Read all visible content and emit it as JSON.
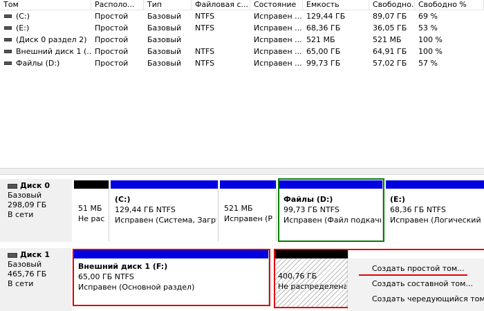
{
  "columns": [
    "Том",
    "Располо...",
    "Тип",
    "Файловая с...",
    "Состояние",
    "Емкость",
    "Свободно...",
    "Свободно %"
  ],
  "volumes": [
    {
      "name": "(C:)",
      "layout": "Простой",
      "type": "Базовый",
      "fs": "NTFS",
      "status": "Исправен ...",
      "capacity": "129,44 ГБ",
      "free": "89,07 ГБ",
      "free_pct": "69 %"
    },
    {
      "name": "(E:)",
      "layout": "Простой",
      "type": "Базовый",
      "fs": "NTFS",
      "status": "Исправен ...",
      "capacity": "68,36 ГБ",
      "free": "36,05 ГБ",
      "free_pct": "53 %"
    },
    {
      "name": "(Диск 0 раздел 2)",
      "layout": "Простой",
      "type": "Базовый",
      "fs": "",
      "status": "Исправен ...",
      "capacity": "521 МБ",
      "free": "521 МБ",
      "free_pct": "100 %"
    },
    {
      "name": "Внешний диск 1 (...",
      "layout": "Простой",
      "type": "Базовый",
      "fs": "NTFS",
      "status": "Исправен ...",
      "capacity": "65,00 ГБ",
      "free": "64,91 ГБ",
      "free_pct": "100 %"
    },
    {
      "name": "Файлы (D:)",
      "layout": "Простой",
      "type": "Базовый",
      "fs": "NTFS",
      "status": "Исправен ...",
      "capacity": "99,73 ГБ",
      "free": "57,02 ГБ",
      "free_pct": "57 %"
    }
  ],
  "disks": [
    {
      "name": "Диск 0",
      "type": "Базовый",
      "size": "298,09 ГБ",
      "state": "В сети",
      "partitions": [
        {
          "title": "",
          "line1": "51 МБ",
          "line2": "Не рас"
        },
        {
          "title": "(C:)",
          "line1": "129,44 ГБ NTFS",
          "line2": "Исправен (Система, Загру"
        },
        {
          "title": "",
          "line1": "521 МБ",
          "line2": "Исправен (Р"
        },
        {
          "title": "Файлы  (D:)",
          "line1": "99,73 ГБ NTFS",
          "line2": "Исправен (Файл подкачк"
        },
        {
          "title": "(E:)",
          "line1": "68,36 ГБ NTFS",
          "line2": "Исправен (Логический д"
        }
      ]
    },
    {
      "name": "Диск 1",
      "type": "Базовый",
      "size": "465,76 ГБ",
      "state": "В сети",
      "partitions": [
        {
          "title": "Внешний диск 1  (F:)",
          "line1": "65,00 ГБ NTFS",
          "line2": "Исправен (Основной раздел)"
        },
        {
          "title": "",
          "line1": "400,76 ГБ",
          "line2": "Не распределена"
        }
      ]
    }
  ],
  "context_menu": [
    "Создать простой том...",
    "Создать составной том...",
    "Создать чередующийся том..."
  ],
  "colors": {
    "primary_bar": "#0000e0",
    "unallocated_bar": "#000000",
    "highlight_red": "#e00000",
    "selection_green": "#008000"
  }
}
